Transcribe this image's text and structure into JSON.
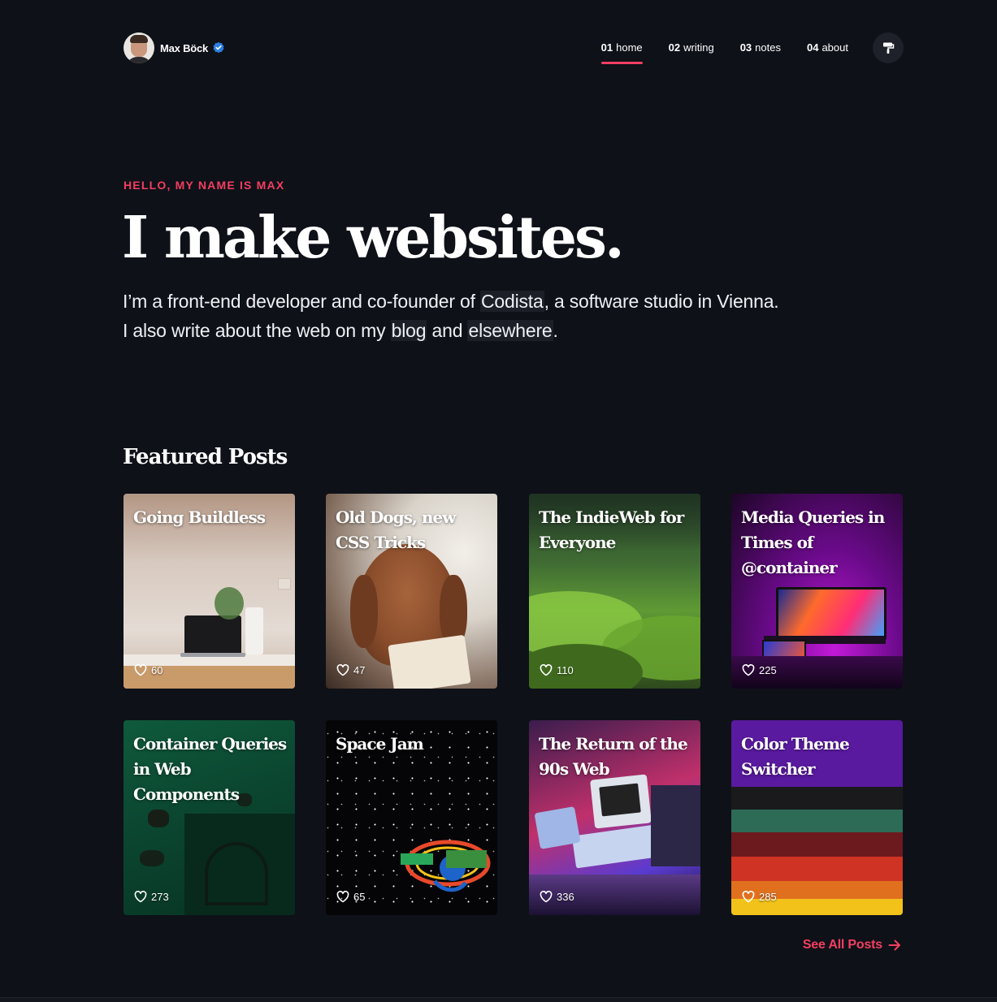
{
  "header": {
    "name": "Max Böck",
    "nav": [
      {
        "num": "01",
        "label": "home",
        "active": true
      },
      {
        "num": "02",
        "label": "writing",
        "active": false
      },
      {
        "num": "03",
        "label": "notes",
        "active": false
      },
      {
        "num": "04",
        "label": "about",
        "active": false
      }
    ],
    "theme_icon": "paint-roller-icon"
  },
  "hero": {
    "kicker": "HELLO, MY NAME IS MAX",
    "headline": "I make websites.",
    "intro_1": "I’m a front-end developer and co-founder of ",
    "link_codista": "Codista",
    "intro_2": ", a software studio in Vienna.",
    "intro_3": "I also write about the web on my ",
    "link_blog": "blog",
    "intro_4": " and ",
    "link_elsewhere": "elsewhere",
    "intro_5": "."
  },
  "featured": {
    "title": "Featured Posts",
    "posts": [
      {
        "title": "Going Buildless",
        "likes": "60"
      },
      {
        "title": "Old Dogs, new CSS Tricks",
        "likes": "47"
      },
      {
        "title": "The IndieWeb for Everyone",
        "likes": "110"
      },
      {
        "title": "Media Queries in Times of @container",
        "likes": "225"
      },
      {
        "title": "Container Queries in Web Components",
        "likes": "273"
      },
      {
        "title": "Space Jam",
        "likes": "65"
      },
      {
        "title": "The Return of the 90s Web",
        "likes": "336"
      },
      {
        "title": "Color Theme Switcher",
        "likes": "285"
      }
    ],
    "see_all": "See All Posts"
  },
  "colors": {
    "accent": "#f33e61",
    "background": "#0e1118",
    "verified": "#2b7fe0"
  }
}
